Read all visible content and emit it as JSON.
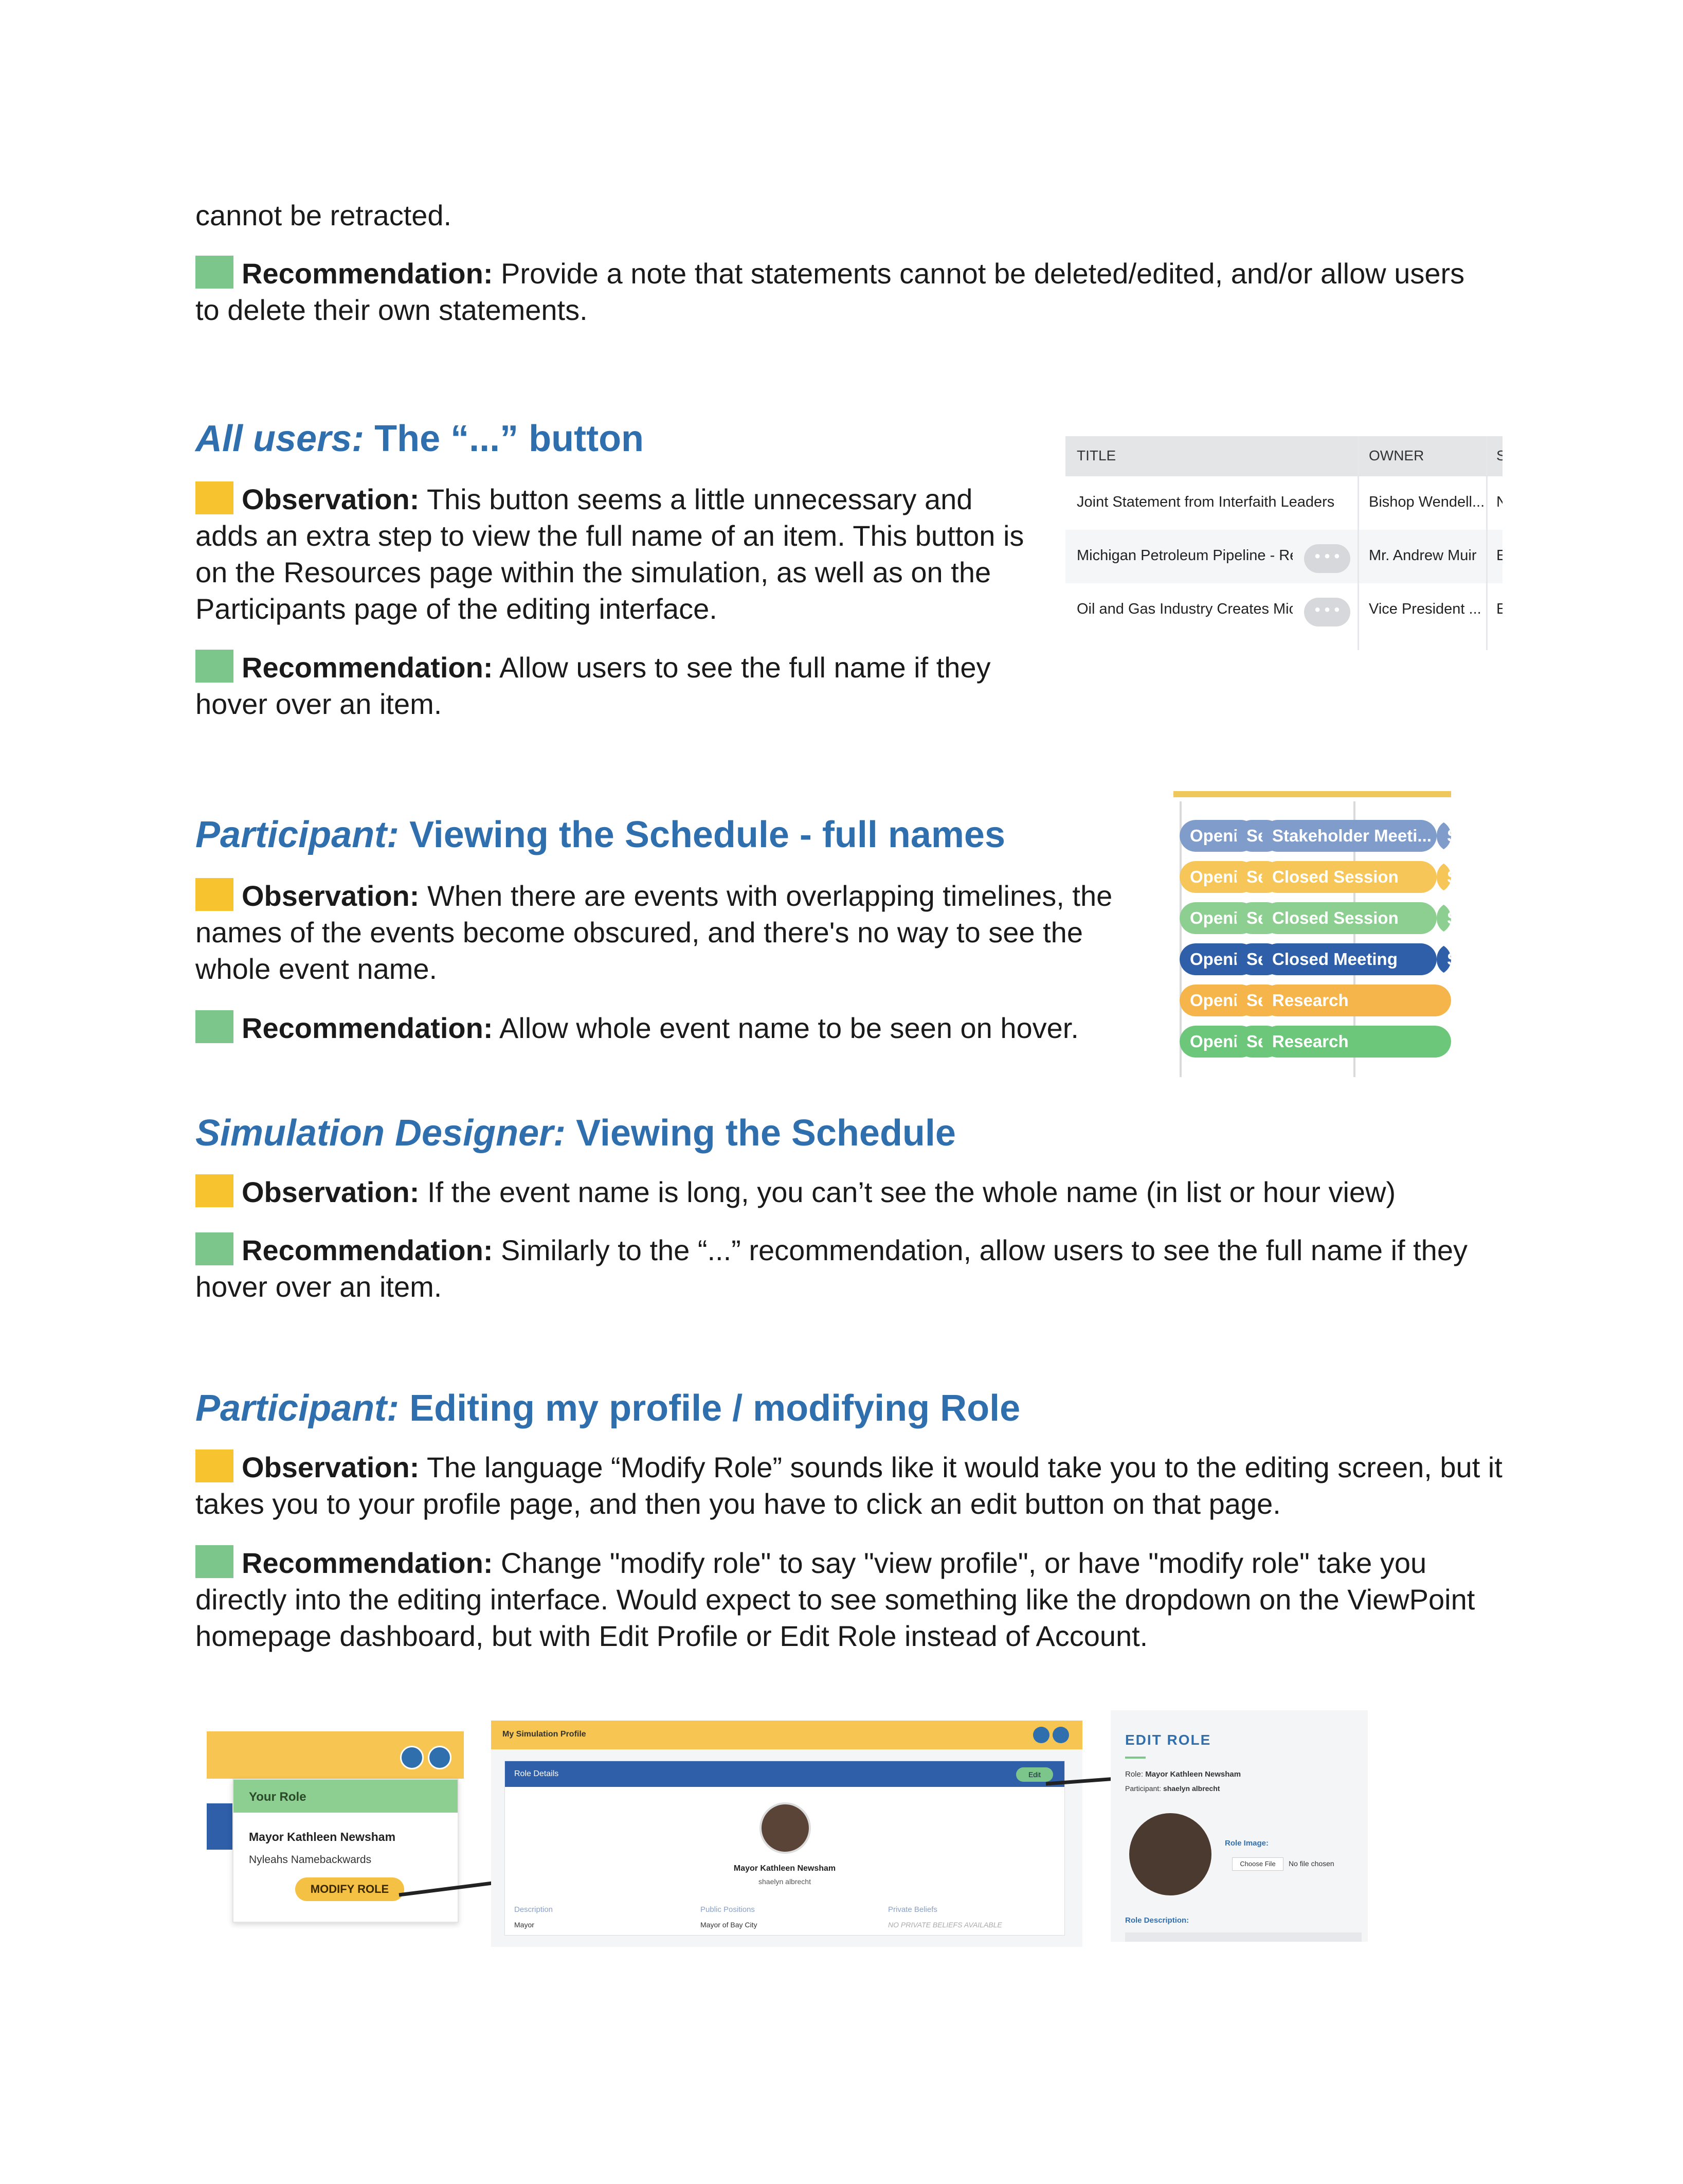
{
  "intro": {
    "continued_text": "cannot be retracted.",
    "rec_label": "Recommendation:",
    "rec_text": " Provide a note that statements cannot be deleted/edited, and/or allow users to delete their own statements."
  },
  "colors": {
    "heading_blue": "#2f6fae",
    "observation_marker": "#f7c430",
    "recommendation_marker": "#7cc68c"
  },
  "sections": [
    {
      "heading_prefix": "All users:",
      "heading_rest": " The “...” button",
      "obs_label": "Observation:",
      "obs_text": " This button seems a little unnecessary and adds an extra step to view the full name of an item. This button is on the Resources page within the simulation, as well as on the Participants page of the editing interface.",
      "rec_label": "Recommendation:",
      "rec_text": " Allow users to see the full name if they hover over an item."
    },
    {
      "heading_prefix": "Participant:",
      "heading_rest": " Viewing the Schedule - full names",
      "obs_label": "Observation:",
      "obs_text": " When there are events with overlapping timelines, the names of the events become obscured, and there's no way to see the whole event name.",
      "rec_label": "Recommendation:",
      "rec_text": " Allow whole event name to be seen on hover."
    },
    {
      "heading_prefix": "Simulation Designer:",
      "heading_rest": " Viewing the Schedule",
      "obs_label": "Observation:",
      "obs_text": " If the event name is long, you can’t see the whole name (in list or hour view)",
      "rec_label": "Recommendation:",
      "rec_text": " Similarly to the “...” recommendation, allow users to see the full name if they hover over an item."
    },
    {
      "heading_prefix": "Participant:",
      "heading_rest": " Editing my profile / modifying Role",
      "obs_label": "Observation:",
      "obs_text": " The language “Modify Role” sounds like it would take you to the editing screen, but it takes you to your profile page, and then you have to click an edit button on that page.",
      "rec_label": "Recommendation:",
      "rec_text": " Change \"modify role\" to say \"view profile\", or have \"modify role\" take you directly into the editing interface. Would expect to see something like the dropdown on the ViewPoint homepage dashboard, but with Edit Profile or Edit Role instead of Account."
    }
  ],
  "resources_table": {
    "columns": [
      "TITLE",
      "OWNER",
      "S"
    ],
    "rows": [
      {
        "title": "Joint Statement from Interfaith Leaders",
        "owner": "Bishop Wendell...",
        "s": "N"
      },
      {
        "title": "Michigan Petroleum Pipeline - Rep",
        "owner": "Mr. Andrew Muir",
        "s": "E"
      },
      {
        "title": "Oil and Gas Industry Creates Mich",
        "owner": "Vice President ...",
        "s": "E"
      }
    ],
    "dots_label": "• • •"
  },
  "schedule": {
    "rows": [
      {
        "a": "Openi",
        "b": "Se",
        "c": "Stakeholder Meeti...",
        "d": "S",
        "color": "#7f9ccb"
      },
      {
        "a": "Openi",
        "b": "Se",
        "c": "Closed Session",
        "d": "S",
        "color": "#f6c659"
      },
      {
        "a": "Openi",
        "b": "Se",
        "c": "Closed Session",
        "d": "S",
        "color": "#8ccf90"
      },
      {
        "a": "Openi",
        "b": "Se",
        "c": "Closed Meeting",
        "d": "S",
        "color": "#2e5fa8"
      },
      {
        "a": "Openi",
        "b": "Se",
        "c": "Research",
        "d": "",
        "color": "#f5b54a"
      },
      {
        "a": "Openi",
        "b": "Se",
        "c": "Research",
        "d": "",
        "color": "#6cc77a"
      }
    ]
  },
  "dropdown_shot": {
    "your_role": "Your Role",
    "role_name": "Mayor Kathleen Newsham",
    "participant": "Nyleahs Namebackwards",
    "modify_btn": "MODIFY ROLE"
  },
  "profile_shot": {
    "header": "My Simulation Profile",
    "role_details": "Role Details",
    "edit_btn": "Edit",
    "name": "Mayor Kathleen Newsham",
    "sub": "shaelyn albrecht",
    "col1_label": "Description",
    "col1_value": "Mayor",
    "col2_label": "Public Positions",
    "col2_value": "Mayor of Bay City",
    "col3_label": "Private Beliefs",
    "col3_value": "NO PRIVATE BELIEFS AVAILABLE"
  },
  "edit_shot": {
    "title": "EDIT ROLE",
    "role_label": "Role:",
    "role_value": "Mayor Kathleen Newsham",
    "participant_label": "Participant:",
    "participant_value": "shaelyn albrecht",
    "image_label": "Role Image:",
    "choose_btn": "Choose File",
    "no_file": "No file chosen",
    "desc_label": "Role Description:"
  }
}
